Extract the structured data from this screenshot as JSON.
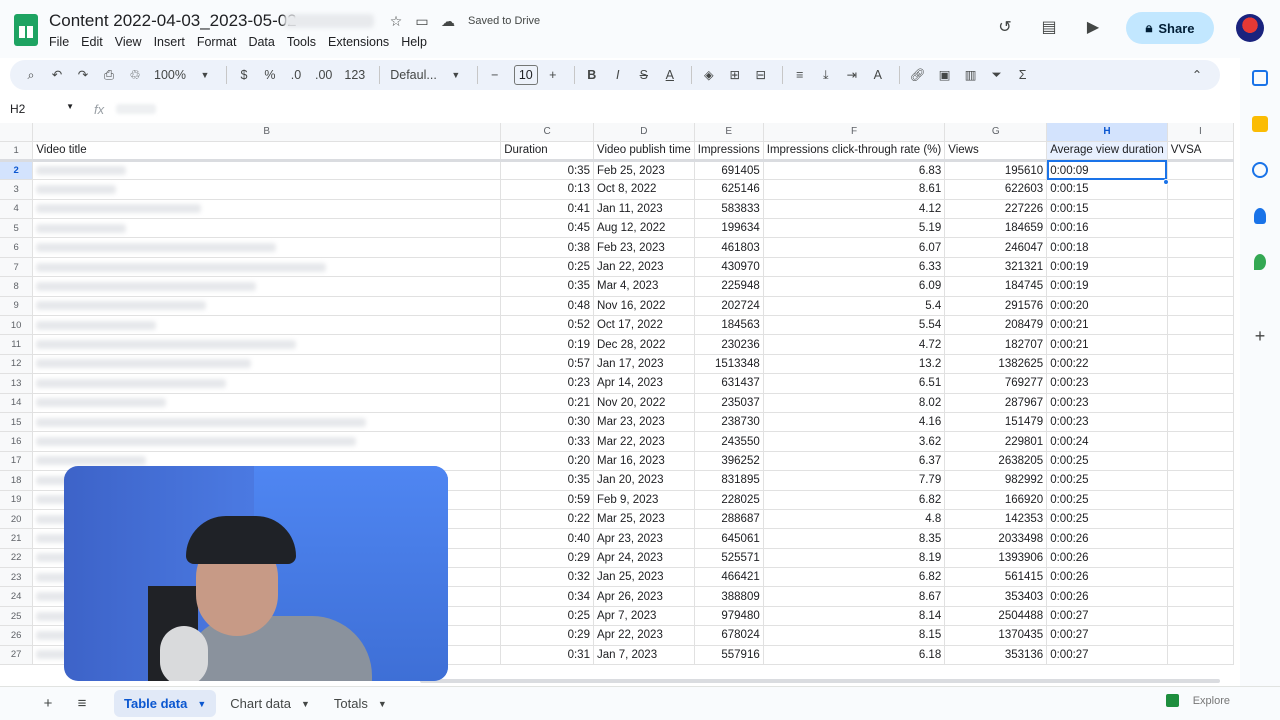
{
  "header": {
    "doc_title": "Content 2022-04-03_2023-05-02",
    "saved_status": "Saved to Drive",
    "share_label": "Share",
    "menu": [
      "File",
      "Edit",
      "View",
      "Insert",
      "Format",
      "Data",
      "Tools",
      "Extensions",
      "Help"
    ]
  },
  "toolbar": {
    "zoom": "100%",
    "currency": "$",
    "percent": "%",
    "decrease_decimal": ".0",
    "increase_decimal": ".00",
    "number_format": "123",
    "font": "Defaul...",
    "font_size": "10"
  },
  "formula_bar": {
    "cell_ref": "H2",
    "fx": "fx"
  },
  "grid": {
    "columns": [
      "",
      "B",
      "C",
      "D",
      "E",
      "F",
      "G",
      "H",
      "I"
    ],
    "header_row": {
      "row_number": "1",
      "cells": [
        "Video title",
        "Duration",
        "Video publish time",
        "Impressions",
        "Impressions click-through rate (%)",
        "Views",
        "Average view duration",
        "VVSA"
      ]
    },
    "rows": [
      {
        "n": "2",
        "dur": "0:35",
        "date": "Feb 25, 2023",
        "imp": "691405",
        "ctr": "6.83",
        "views": "195610",
        "avd": "0:00:09"
      },
      {
        "n": "3",
        "dur": "0:13",
        "date": "Oct 8, 2022",
        "imp": "625146",
        "ctr": "8.61",
        "views": "622603",
        "avd": "0:00:15"
      },
      {
        "n": "4",
        "dur": "0:41",
        "date": "Jan 11, 2023",
        "imp": "583833",
        "ctr": "4.12",
        "views": "227226",
        "avd": "0:00:15"
      },
      {
        "n": "5",
        "dur": "0:45",
        "date": "Aug 12, 2022",
        "imp": "199634",
        "ctr": "5.19",
        "views": "184659",
        "avd": "0:00:16"
      },
      {
        "n": "6",
        "dur": "0:38",
        "date": "Feb 23, 2023",
        "imp": "461803",
        "ctr": "6.07",
        "views": "246047",
        "avd": "0:00:18"
      },
      {
        "n": "7",
        "dur": "0:25",
        "date": "Jan 22, 2023",
        "imp": "430970",
        "ctr": "6.33",
        "views": "321321",
        "avd": "0:00:19"
      },
      {
        "n": "8",
        "dur": "0:35",
        "date": "Mar 4, 2023",
        "imp": "225948",
        "ctr": "6.09",
        "views": "184745",
        "avd": "0:00:19"
      },
      {
        "n": "9",
        "dur": "0:48",
        "date": "Nov 16, 2022",
        "imp": "202724",
        "ctr": "5.4",
        "views": "291576",
        "avd": "0:00:20"
      },
      {
        "n": "10",
        "dur": "0:52",
        "date": "Oct 17, 2022",
        "imp": "184563",
        "ctr": "5.54",
        "views": "208479",
        "avd": "0:00:21"
      },
      {
        "n": "11",
        "dur": "0:19",
        "date": "Dec 28, 2022",
        "imp": "230236",
        "ctr": "4.72",
        "views": "182707",
        "avd": "0:00:21"
      },
      {
        "n": "12",
        "dur": "0:57",
        "date": "Jan 17, 2023",
        "imp": "1513348",
        "ctr": "13.2",
        "views": "1382625",
        "avd": "0:00:22"
      },
      {
        "n": "13",
        "dur": "0:23",
        "date": "Apr 14, 2023",
        "imp": "631437",
        "ctr": "6.51",
        "views": "769277",
        "avd": "0:00:23"
      },
      {
        "n": "14",
        "dur": "0:21",
        "date": "Nov 20, 2022",
        "imp": "235037",
        "ctr": "8.02",
        "views": "287967",
        "avd": "0:00:23"
      },
      {
        "n": "15",
        "dur": "0:30",
        "date": "Mar 23, 2023",
        "imp": "238730",
        "ctr": "4.16",
        "views": "151479",
        "avd": "0:00:23"
      },
      {
        "n": "16",
        "dur": "0:33",
        "date": "Mar 22, 2023",
        "imp": "243550",
        "ctr": "3.62",
        "views": "229801",
        "avd": "0:00:24"
      },
      {
        "n": "17",
        "dur": "0:20",
        "date": "Mar 16, 2023",
        "imp": "396252",
        "ctr": "6.37",
        "views": "2638205",
        "avd": "0:00:25"
      },
      {
        "n": "18",
        "dur": "0:35",
        "date": "Jan 20, 2023",
        "imp": "831895",
        "ctr": "7.79",
        "views": "982992",
        "avd": "0:00:25"
      },
      {
        "n": "19",
        "dur": "0:59",
        "date": "Feb 9, 2023",
        "imp": "228025",
        "ctr": "6.82",
        "views": "166920",
        "avd": "0:00:25"
      },
      {
        "n": "20",
        "dur": "0:22",
        "date": "Mar 25, 2023",
        "imp": "288687",
        "ctr": "4.8",
        "views": "142353",
        "avd": "0:00:25"
      },
      {
        "n": "21",
        "dur": "0:40",
        "date": "Apr 23, 2023",
        "imp": "645061",
        "ctr": "8.35",
        "views": "2033498",
        "avd": "0:00:26"
      },
      {
        "n": "22",
        "dur": "0:29",
        "date": "Apr 24, 2023",
        "imp": "525571",
        "ctr": "8.19",
        "views": "1393906",
        "avd": "0:00:26"
      },
      {
        "n": "23",
        "dur": "0:32",
        "date": "Jan 25, 2023",
        "imp": "466421",
        "ctr": "6.82",
        "views": "561415",
        "avd": "0:00:26"
      },
      {
        "n": "24",
        "dur": "0:34",
        "date": "Apr 26, 2023",
        "imp": "388809",
        "ctr": "8.67",
        "views": "353403",
        "avd": "0:00:26"
      },
      {
        "n": "25",
        "dur": "0:25",
        "date": "Apr 7, 2023",
        "imp": "979480",
        "ctr": "8.14",
        "views": "2504488",
        "avd": "0:00:27"
      },
      {
        "n": "26",
        "dur": "0:29",
        "date": "Apr 22, 2023",
        "imp": "678024",
        "ctr": "8.15",
        "views": "1370435",
        "avd": "0:00:27"
      },
      {
        "n": "27",
        "dur": "0:31",
        "date": "Jan 7, 2023",
        "imp": "557916",
        "ctr": "6.18",
        "views": "353136",
        "avd": "0:00:27"
      }
    ]
  },
  "sheets": {
    "tabs": [
      "Table data",
      "Chart data",
      "Totals"
    ],
    "explore_label": "Explore"
  },
  "colors": {
    "accent": "#1a73e8",
    "sheets_green": "#1ea362",
    "share_bg": "#c2e7ff"
  }
}
